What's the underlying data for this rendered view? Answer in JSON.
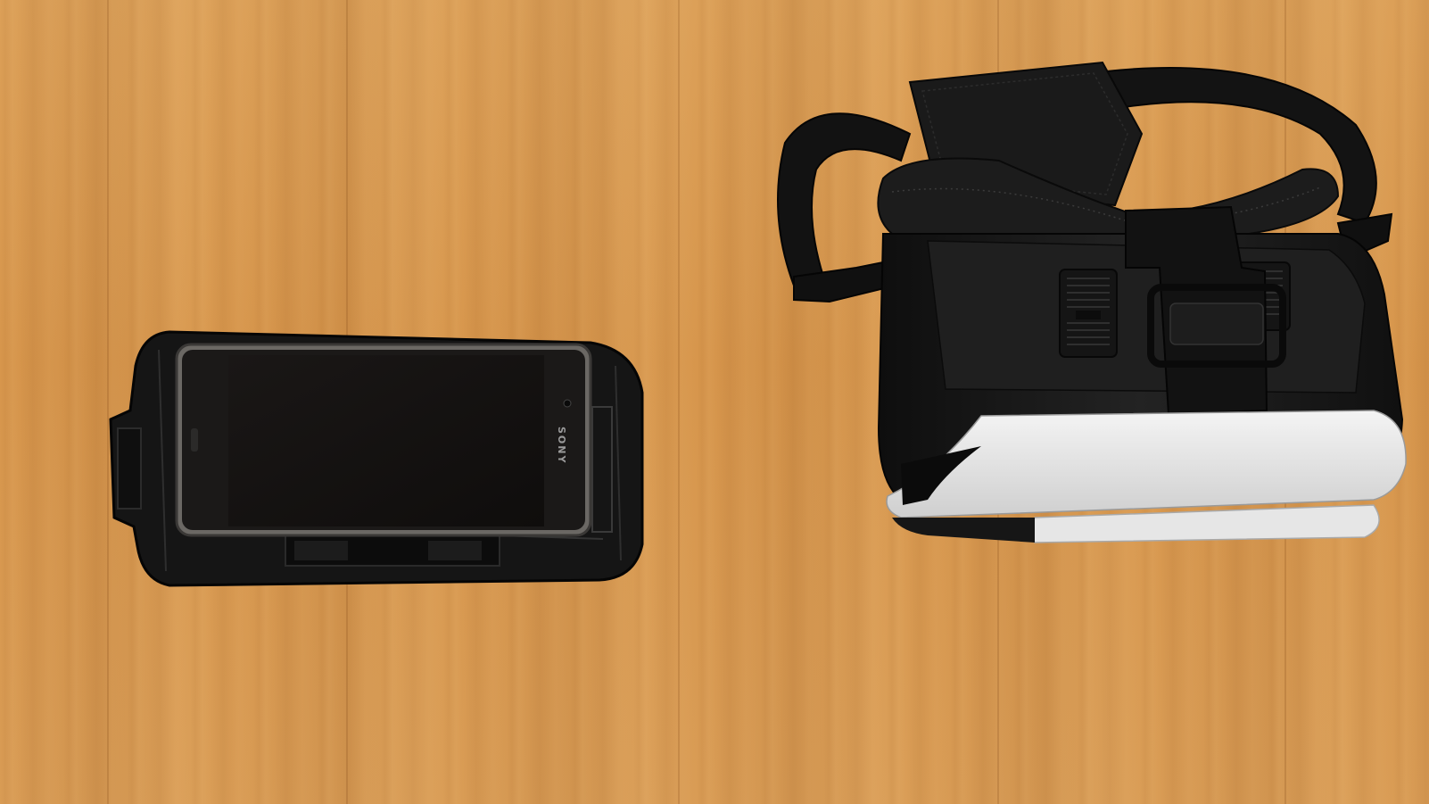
{
  "scene": {
    "surface": "wooden-table",
    "colors": {
      "wood": "#d89a4f",
      "plastic_black": "#141414",
      "phone_screen": "#141211",
      "phone_frame": "#6d6a66",
      "headset_white": "#ececec"
    }
  },
  "phone": {
    "brand": "SONY"
  },
  "objects": [
    "phone-holder-tray",
    "smartphone",
    "vr-headset"
  ]
}
